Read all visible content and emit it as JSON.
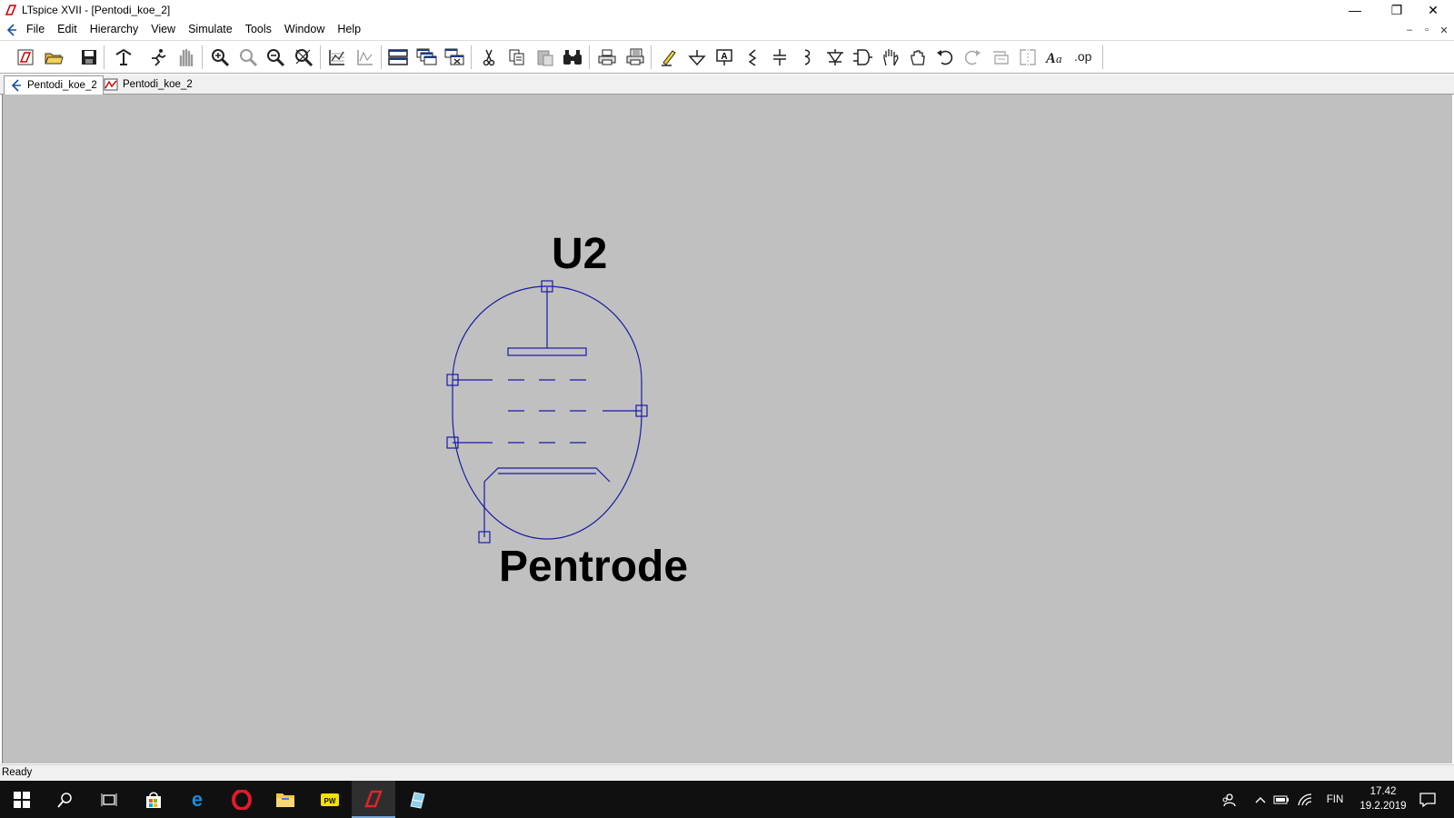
{
  "window": {
    "title": "LTspice XVII - [Pentodi_koe_2]",
    "controls": [
      "—",
      "❐",
      "✕"
    ],
    "mdi_controls": [
      "–",
      "▫",
      "✕"
    ]
  },
  "menu": {
    "items": [
      "File",
      "Edit",
      "Hierarchy",
      "View",
      "Simulate",
      "Tools",
      "Window",
      "Help"
    ]
  },
  "toolbar": {
    "buttons": [
      {
        "icon": "new-schematic-icon"
      },
      {
        "icon": "open-folder-icon"
      },
      {
        "icon": "save-icon"
      },
      {
        "icon": "control-panel-icon"
      },
      {
        "icon": "run-icon"
      },
      {
        "icon": "halt-icon"
      },
      {
        "icon": "zoom-in-icon"
      },
      {
        "icon": "pan-icon"
      },
      {
        "icon": "zoom-out-icon"
      },
      {
        "icon": "zoom-fit-icon"
      },
      {
        "icon": "autoscale-icon"
      },
      {
        "icon": "waveform-icon"
      },
      {
        "icon": "tile-horizontal-icon"
      },
      {
        "icon": "cascade-icon"
      },
      {
        "icon": "close-windows-icon"
      },
      {
        "icon": "cut-icon"
      },
      {
        "icon": "copy-icon"
      },
      {
        "icon": "paste-icon"
      },
      {
        "icon": "find-icon"
      },
      {
        "icon": "print-icon"
      },
      {
        "icon": "print-preview-icon"
      },
      {
        "icon": "draw-wire-icon"
      },
      {
        "icon": "ground-icon"
      },
      {
        "icon": "label-net-icon"
      },
      {
        "icon": "resistor-icon"
      },
      {
        "icon": "capacitor-icon"
      },
      {
        "icon": "inductor-icon"
      },
      {
        "icon": "diode-icon"
      },
      {
        "icon": "component-icon"
      },
      {
        "icon": "move-icon"
      },
      {
        "icon": "drag-icon"
      },
      {
        "icon": "undo-icon"
      },
      {
        "icon": "redo-icon"
      },
      {
        "icon": "rotate-icon"
      },
      {
        "icon": "mirror-icon"
      },
      {
        "icon": "text-icon"
      },
      {
        "icon": "spice-directive-icon"
      }
    ]
  },
  "tabs": [
    {
      "label": "Pentodi_koe_2",
      "icon": "schematic-tab-icon",
      "active": true
    },
    {
      "label": "Pentodi_koe_2",
      "icon": "waveform-tab-icon",
      "active": false
    }
  ],
  "schematic": {
    "instance_name": "U2",
    "component_value": "Pentrode",
    "symbol_color": "#1a1aa6",
    "background": "#c0c0c0"
  },
  "status": {
    "text": "Ready"
  },
  "taskbar": {
    "apps": [
      {
        "icon": "windows-start-icon"
      },
      {
        "icon": "search-icon"
      },
      {
        "icon": "task-view-icon"
      },
      {
        "icon": "store-icon"
      },
      {
        "icon": "edge-icon"
      },
      {
        "icon": "opera-icon"
      },
      {
        "icon": "file-explorer-icon"
      },
      {
        "icon": "app-yellow-icon"
      },
      {
        "icon": "ltspice-icon"
      },
      {
        "icon": "app-blue-icon"
      }
    ],
    "language": "FIN",
    "time": "17.42",
    "date": "19.2.2019"
  }
}
